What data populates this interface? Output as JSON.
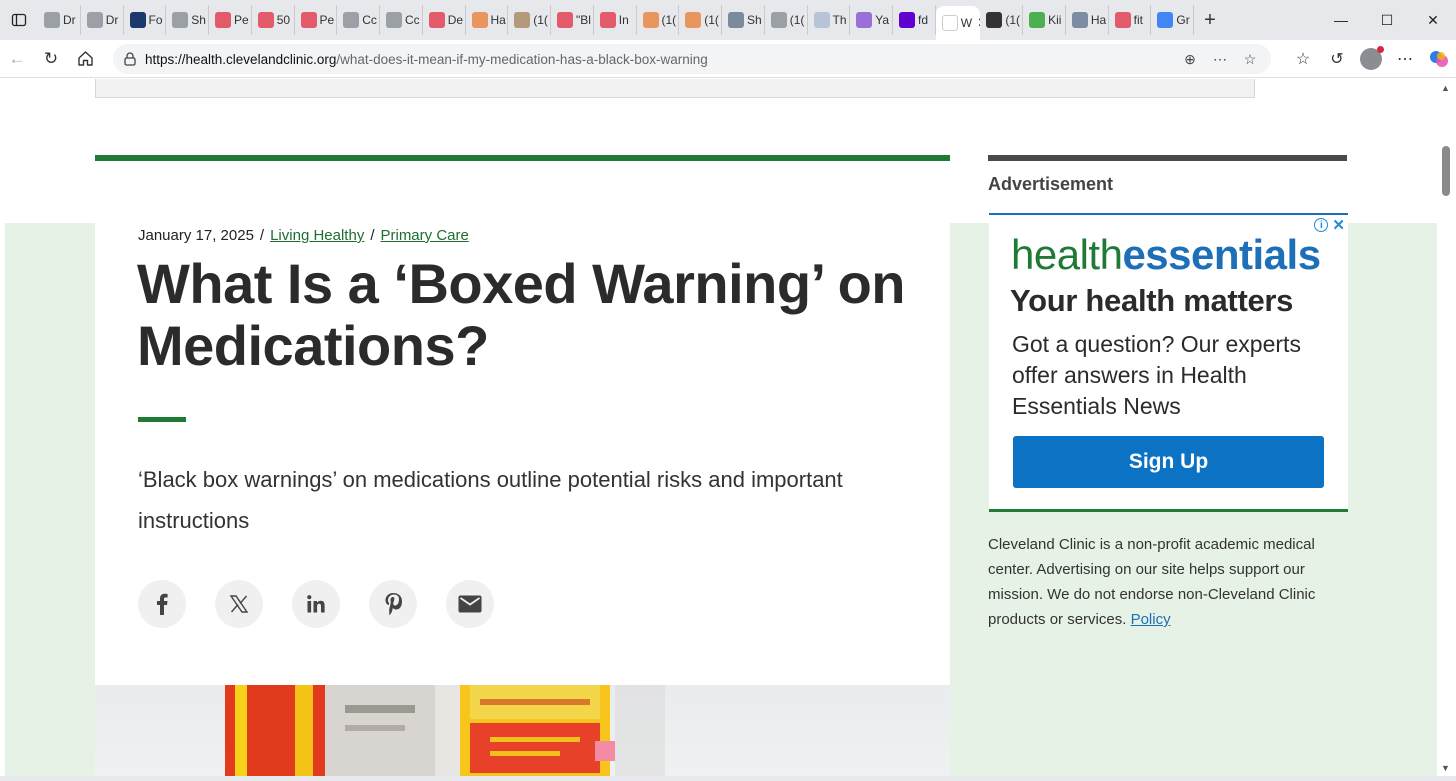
{
  "browser": {
    "tabs": [
      {
        "title": "Dr",
        "icon": "globe-icon",
        "color": "#9aa0a6"
      },
      {
        "title": "Dr",
        "icon": "globe-icon",
        "color": "#9aa0a6"
      },
      {
        "title": "Fo",
        "icon": "fox-news-icon",
        "color": "#1b3a6b"
      },
      {
        "title": "Sh",
        "icon": "globe-icon",
        "color": "#9aa0a6"
      },
      {
        "title": "Pe",
        "icon": "youtube-icon",
        "color": "#e35a6b"
      },
      {
        "title": "50",
        "icon": "youtube-icon",
        "color": "#e35a6b"
      },
      {
        "title": "Pe",
        "icon": "youtube-icon",
        "color": "#e35a6b"
      },
      {
        "title": "Cc",
        "icon": "globe-icon",
        "color": "#9aa0a6"
      },
      {
        "title": "Cc",
        "icon": "globe-icon",
        "color": "#9aa0a6"
      },
      {
        "title": "De",
        "icon": "youtube-icon",
        "color": "#e35a6b"
      },
      {
        "title": "Ha",
        "icon": "blogger-icon",
        "color": "#e8955e"
      },
      {
        "title": "(1(",
        "icon": "image-icon",
        "color": "#b39b7a"
      },
      {
        "title": "\"Bl",
        "icon": "youtube-icon",
        "color": "#e35a6b"
      },
      {
        "title": "In",
        "icon": "youtube-icon",
        "color": "#e35a6b"
      },
      {
        "title": "(1(",
        "icon": "bookmark-icon",
        "color": "#e8955e"
      },
      {
        "title": "(1(",
        "icon": "bookmark-icon",
        "color": "#e8955e"
      },
      {
        "title": "Sh",
        "icon": "medium-icon",
        "color": "#7c8a9c"
      },
      {
        "title": "(1(",
        "icon": "image-icon",
        "color": "#9aa0a6"
      },
      {
        "title": "Th",
        "icon": "gp-icon",
        "color": "#b7c4d8"
      },
      {
        "title": "Ya",
        "icon": "yahoo-icon",
        "color": "#9b6fd8"
      },
      {
        "title": "fd",
        "icon": "yahoo-icon",
        "color": "#5f01d1"
      },
      {
        "title": "W",
        "icon": "cleveland-clinic-icon",
        "color": "#ffffff",
        "active": true
      },
      {
        "title": "(1(",
        "icon": "fp-icon",
        "color": "#333333"
      },
      {
        "title": "Kii",
        "icon": "image-icon",
        "color": "#4caf50"
      },
      {
        "title": "Ha",
        "icon": "image-icon",
        "color": "#7d8ca3"
      },
      {
        "title": "fit",
        "icon": "youtube-icon",
        "color": "#e35a6b"
      },
      {
        "title": "Gr",
        "icon": "google-icon",
        "color": "#4285f4"
      }
    ],
    "url_host": "https://health.clevelandclinic.org",
    "url_path": "/what-does-it-mean-if-my-medication-has-a-black-box-warning"
  },
  "article": {
    "date": "January 17, 2025",
    "sep1": "/",
    "category1": "Living Healthy",
    "sep2": "/",
    "category2": "Primary Care",
    "title": "What Is a ‘Boxed Warning’ on Medications?",
    "summary": "‘Black box warnings’ on medications outline potential risks and important instructions",
    "share_icons": [
      "facebook-icon",
      "x-icon",
      "linkedin-icon",
      "pinterest-icon",
      "email-icon"
    ],
    "accent_color": "#1e7a34"
  },
  "sidebar": {
    "ad_label": "Advertisement",
    "ad": {
      "brand_part1": "health",
      "brand_part2": "essentials",
      "headline": "Your health matters",
      "body": "Got a question? Our experts offer answers in Health Essentials News",
      "button": "Sign Up",
      "info_glyph": "i",
      "close_glyph": "✕"
    },
    "disclaimer": "Cleveland Clinic is a non-profit academic medical center. Advertising on our site helps support our mission. We do not endorse non-Cleveland Clinic products or services.",
    "policy_link": "Policy"
  }
}
